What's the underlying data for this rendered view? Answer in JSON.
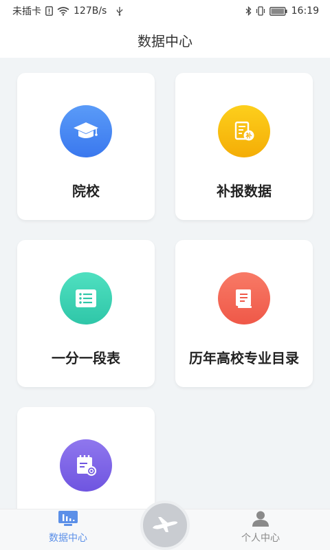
{
  "status_bar": {
    "carrier": "未插卡",
    "speed": "127B/s",
    "time": "16:19"
  },
  "header": {
    "title": "数据中心"
  },
  "cards": [
    {
      "label": "院校",
      "icon": "graduation-cap-icon",
      "color": "#4a8af4"
    },
    {
      "label": "补报数据",
      "icon": "supplement-document-icon",
      "color": "#f9bd0f"
    },
    {
      "label": "一分一段表",
      "icon": "list-icon",
      "color": "#3fd4b4"
    },
    {
      "label": "历年高校专业目录",
      "icon": "book-icon",
      "color": "#f46a56"
    },
    {
      "label": "",
      "icon": "calendar-search-icon",
      "color": "#7f66e8"
    }
  ],
  "tabbar": {
    "left_label": "数据中心",
    "right_label": "个人中心",
    "active_color": "#5b8fe8",
    "inactive_color": "#888888"
  }
}
